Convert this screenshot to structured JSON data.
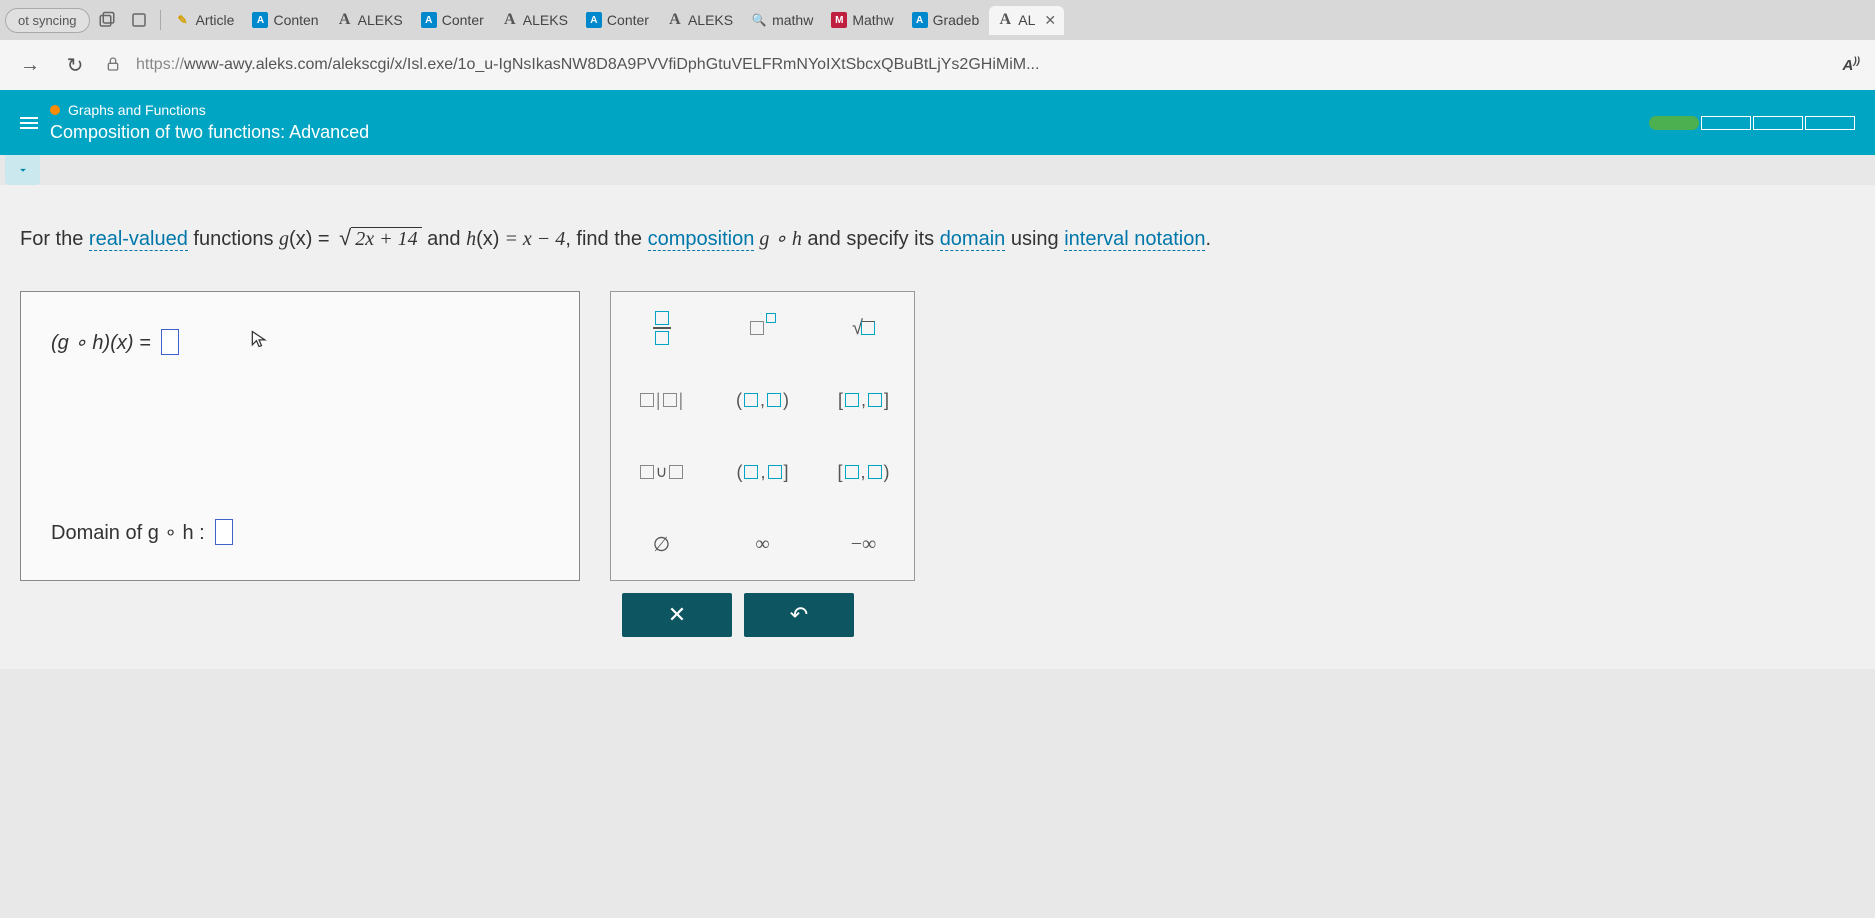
{
  "browser": {
    "sync_status": "ot syncing",
    "tabs": [
      {
        "label": "Article"
      },
      {
        "label": "Conten"
      },
      {
        "label": "ALEKS"
      },
      {
        "label": "Conter"
      },
      {
        "label": "ALEKS"
      },
      {
        "label": "Conter"
      },
      {
        "label": "ALEKS"
      },
      {
        "label": "mathw"
      },
      {
        "label": "Mathw"
      },
      {
        "label": "Gradeb"
      },
      {
        "label": "AL"
      }
    ],
    "url_protocol": "https://",
    "url_rest": "www-awy.aleks.com/alekscgi/x/Isl.exe/1o_u-IgNsIkasNW8D8A9PVVfiDphGtuVELFRmNYoIXtSbcxQBuBtLjYs2GHiMiM...",
    "ext_label": "A"
  },
  "header": {
    "category": "Graphs and Functions",
    "title": "Composition of two functions: Advanced"
  },
  "question": {
    "prefix": "For the ",
    "link1": "real-valued",
    "mid1": " functions ",
    "g_label": "g",
    "g_open": "(x)",
    "eq": " = ",
    "radicand": "2x + 14",
    "and": " and ",
    "h_label": "h",
    "h_open": "(x)",
    "h_eq": " = x − 4",
    "mid2": ", find the ",
    "link2": "composition",
    "comp": " g ∘ h",
    "mid3": " and specify its ",
    "link3": "domain",
    "mid4": " using ",
    "link4": "interval notation",
    "end": "."
  },
  "answer": {
    "row1_label": "(g ∘ h)(x)  =",
    "row2_label": "Domain of g ∘ h  :"
  },
  "palette": {
    "empty_set": "∅",
    "infinity": "∞",
    "neg_infinity": "−∞",
    "clear": "✕",
    "undo": "↶"
  }
}
